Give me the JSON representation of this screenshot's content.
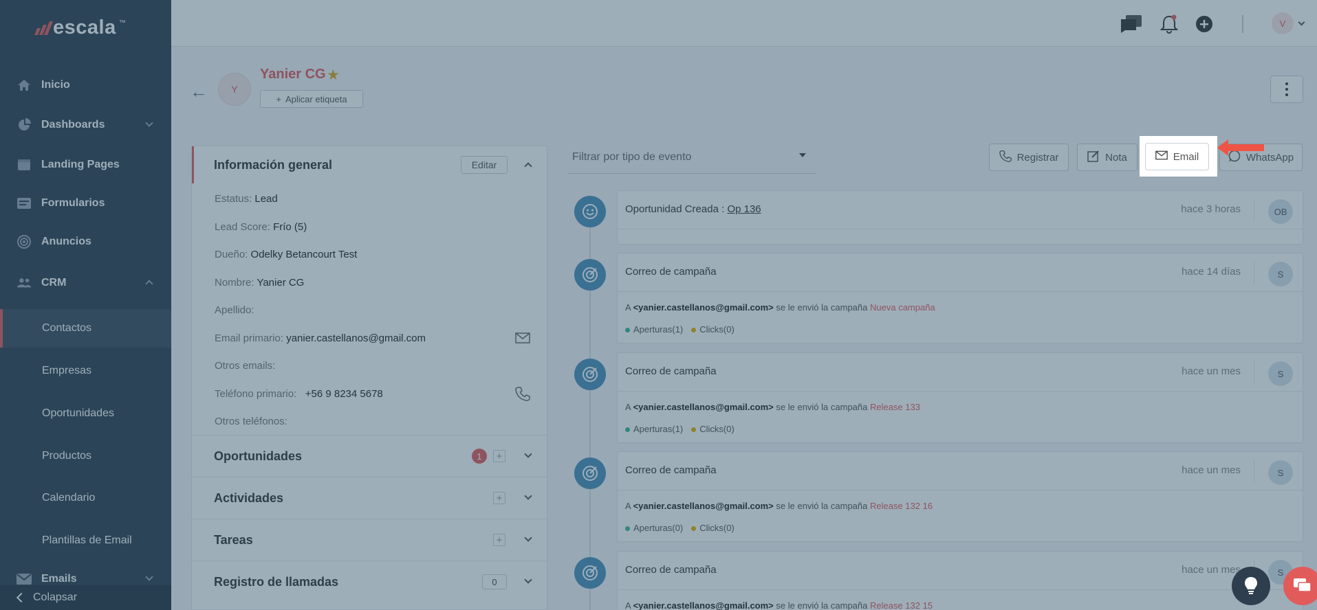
{
  "brand": {
    "name": "escala",
    "tm": "™",
    "accent": "#e25b5b",
    "sidebar_bg": "#2e3e4e"
  },
  "sidebar": {
    "items": [
      {
        "label": "Inicio",
        "icon": "home-icon"
      },
      {
        "label": "Dashboards",
        "icon": "pie-chart-icon"
      },
      {
        "label": "Landing Pages",
        "icon": "browser-icon"
      },
      {
        "label": "Formularios",
        "icon": "form-icon"
      },
      {
        "label": "Anuncios",
        "icon": "target-icon"
      },
      {
        "label": "CRM",
        "icon": "users-icon"
      }
    ],
    "crm_subitems": [
      "Contactos",
      "Empresas",
      "Oportunidades",
      "Productos",
      "Calendario",
      "Plantillas de Email"
    ],
    "emails_label": "Emails",
    "collapse_label": "Colapsar"
  },
  "topbar": {
    "avatar_initial": "V"
  },
  "contact": {
    "avatar_initial": "Y",
    "name": "Yanier CG",
    "tag_button": "Aplicar etiqueta"
  },
  "info": {
    "title": "Información general",
    "edit_label": "Editar",
    "fields": [
      {
        "label": "Estatus:",
        "value": "Lead"
      },
      {
        "label": "Lead Score:",
        "value": "Frío (5)"
      },
      {
        "label": "Dueño:",
        "value": "Odelky Betancourt Test"
      },
      {
        "label": "Nombre:",
        "value": "Yanier CG"
      },
      {
        "label": "Apellido:",
        "value": ""
      },
      {
        "label": "Email primario:",
        "value": "yanier.castellanos@gmail.com"
      },
      {
        "label": "Otros emails:",
        "value": ""
      },
      {
        "label": "Teléfono primario:",
        "value": "+56 9 8234 5678"
      },
      {
        "label": "Otros teléfonos:",
        "value": ""
      }
    ]
  },
  "sections": {
    "oportunidades": {
      "title": "Oportunidades",
      "count": "1"
    },
    "actividades": {
      "title": "Actividades"
    },
    "tareas": {
      "title": "Tareas"
    },
    "llamadas": {
      "title": "Registro de llamadas",
      "count": "0"
    }
  },
  "filter": {
    "placeholder": "Filtrar por tipo de evento"
  },
  "actions": {
    "registrar": "Registrar",
    "nota": "Nota",
    "email": "Email",
    "whatsapp": "WhatsApp"
  },
  "timeline": [
    {
      "title": "Oportunidad Creada :",
      "link": "Op 136",
      "time": "hace 3 horas",
      "avatar": "OB"
    },
    {
      "title": "Correo de campaña",
      "time": "hace 14 días",
      "avatar": "S",
      "to": "<yanier.castellanos@gmail.com>",
      "mid": "se le envió la campaña",
      "campaign": "Nueva campaña",
      "aperturas": "Aperturas(1)",
      "clicks": "Clicks(0)"
    },
    {
      "title": "Correo de campaña",
      "time": "hace un mes",
      "avatar": "S",
      "to": "<yanier.castellanos@gmail.com>",
      "mid": "se le envió la campaña",
      "campaign": "Release 133",
      "aperturas": "Aperturas(1)",
      "clicks": "Clicks(0)"
    },
    {
      "title": "Correo de campaña",
      "time": "hace un mes",
      "avatar": "S",
      "to": "<yanier.castellanos@gmail.com>",
      "mid": "se le envió la campaña",
      "campaign": "Release 132 16",
      "aperturas": "Aperturas(0)",
      "clicks": "Clicks(0)"
    },
    {
      "title": "Correo de campaña",
      "time": "hace un mes",
      "avatar": "S",
      "to": "<yanier.castellanos@gmail.com>",
      "mid": "se le envió la campaña",
      "campaign": "Release 132 15"
    }
  ],
  "body_prefix": "A"
}
